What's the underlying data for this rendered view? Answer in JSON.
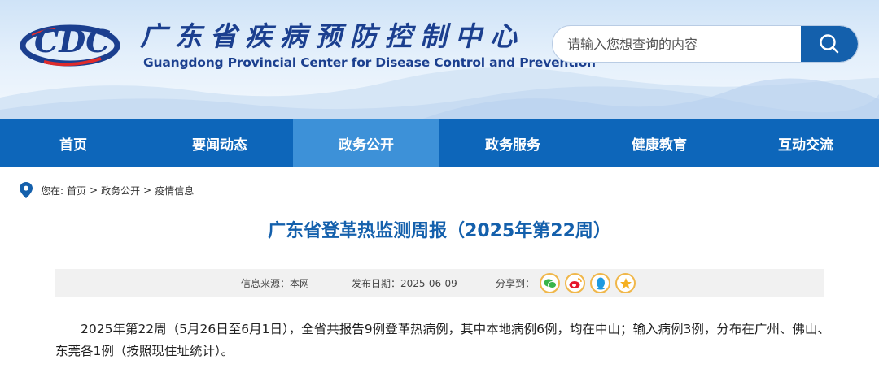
{
  "header": {
    "logo_text": "CDC",
    "cn_title": "广东省疾病预防控制中心",
    "en_title": "Guangdong Provincial Center for Disease Control and Prevention"
  },
  "search": {
    "placeholder": "请输入您想查询的内容"
  },
  "nav": {
    "items": [
      {
        "label": "首页"
      },
      {
        "label": "要闻动态"
      },
      {
        "label": "政务公开"
      },
      {
        "label": "政务服务"
      },
      {
        "label": "健康教育"
      },
      {
        "label": "互动交流"
      }
    ],
    "active": "政务公开"
  },
  "breadcrumb": {
    "prefix": "您在:",
    "items": [
      "首页",
      "政务公开",
      "疫情信息"
    ],
    "separator": ">"
  },
  "article": {
    "title": "广东省登革热监测周报（2025年第22周）",
    "source_label": "信息来源：本网",
    "date_label": "发布日期：2025-06-09",
    "share_label": "分享到：",
    "paragraph": "2025年第22周（5月26日至6月1日），全省共报告9例登革热病例，其中本地病例6例，均在中山；输入病例3例，分布在广州、佛山、东莞各1例（按照现住址统计）。"
  },
  "share_icons": [
    "wechat-icon",
    "weibo-icon",
    "qq-icon",
    "qzone-icon"
  ],
  "colors": {
    "nav_bg": "#0d66ba",
    "nav_active": "#3d91d8",
    "title": "#1460ac",
    "brand": "#1b3f8f"
  }
}
